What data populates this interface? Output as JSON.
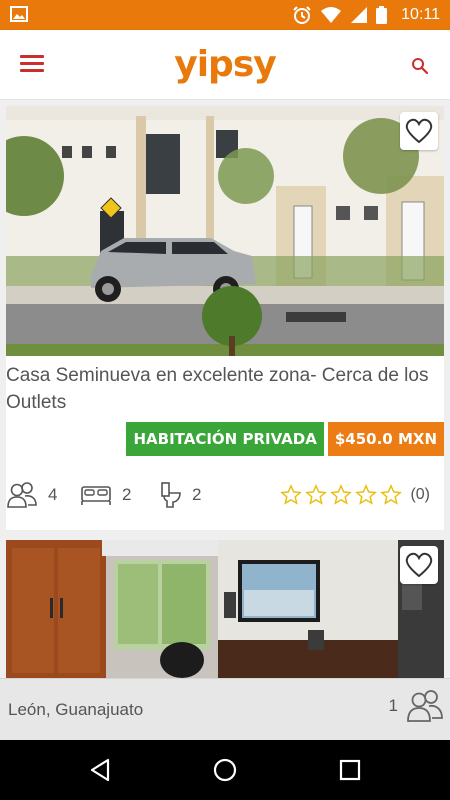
{
  "status_bar": {
    "time": "10:11",
    "icons": [
      "image-icon",
      "alarm-icon",
      "wifi-icon",
      "signal-icon",
      "battery-icon"
    ],
    "color": "#e8790a"
  },
  "header": {
    "logo": "yipsy",
    "menu_icon": "hamburger-menu-icon",
    "search_icon": "search-icon",
    "brand_color": "#e8790a",
    "accent_color": "#c9302c"
  },
  "listings": [
    {
      "title": "Casa Seminueva en excelente zona- Cerca de los Outlets",
      "room_type": "HABITACIÓN PRIVADA",
      "price": "$450.0 MXN",
      "guests": "4",
      "beds": "2",
      "baths": "2",
      "rating_count": "(0)",
      "rating": 0,
      "max_rating": 5,
      "photo": "house-exterior-with-suv"
    },
    {
      "photo": "living-room-with-tv"
    }
  ],
  "location_bar": {
    "location": "León, Guanajuato",
    "guests": "1"
  },
  "nav_bar": {
    "icons": [
      "back-icon",
      "home-icon",
      "recents-icon"
    ]
  },
  "colors": {
    "green_badge": "#3aa63a",
    "orange_badge": "#ec7c14",
    "star": "#e8c010"
  }
}
